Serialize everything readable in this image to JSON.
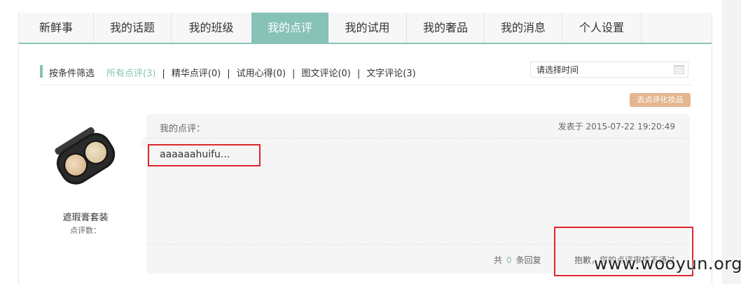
{
  "tabs": [
    {
      "label": "新鲜事"
    },
    {
      "label": "我的话题"
    },
    {
      "label": "我的班级"
    },
    {
      "label": "我的点评"
    },
    {
      "label": "我的试用"
    },
    {
      "label": "我的奢品"
    },
    {
      "label": "我的消息"
    },
    {
      "label": "个人设置"
    }
  ],
  "active_tab": "我的点评",
  "filter": {
    "label": "按条件筛选",
    "options": [
      {
        "label": "所有点评(3)",
        "active": true
      },
      {
        "label": "精华点评(0)"
      },
      {
        "label": "试用心得(0)"
      },
      {
        "label": "图文评论(0)"
      },
      {
        "label": "文字评论(3)"
      }
    ],
    "date_placeholder": "请选择时间"
  },
  "goto_button": "去点评化妆品",
  "product": {
    "name": "遮瑕膏套装",
    "review_count_label": "点评数："
  },
  "review": {
    "title": "我的点评：",
    "time": "发表于 2015-07-22 19:20:49",
    "content": "aaaaaahuifu...",
    "reply_prefix": "共",
    "reply_count": "0",
    "reply_suffix": "条回复",
    "status": "抱歉，您的点评审核不通过"
  },
  "watermark": "www.wooyun.org",
  "colors": {
    "accent": "#86c2b8",
    "button": "#e3b68f",
    "highlight": "#e0262c"
  },
  "icons": [
    "calendar-icon"
  ]
}
